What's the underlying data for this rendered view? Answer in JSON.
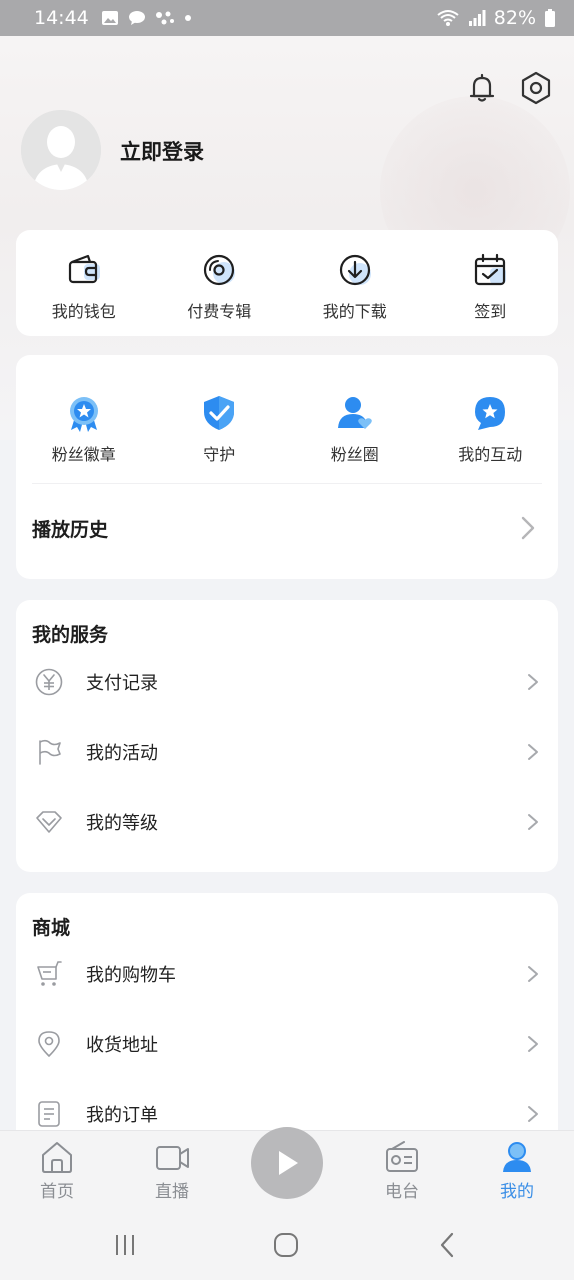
{
  "status_bar": {
    "time": "14:44",
    "battery": "82%"
  },
  "profile": {
    "login_label": "立即登录"
  },
  "quick_actions": [
    {
      "label": "我的钱包",
      "icon": "wallet-icon"
    },
    {
      "label": "付费专辑",
      "icon": "disc-icon"
    },
    {
      "label": "我的下载",
      "icon": "download-icon"
    },
    {
      "label": "签到",
      "icon": "calendar-check-icon"
    }
  ],
  "fan_actions": [
    {
      "label": "粉丝徽章",
      "icon": "badge-icon"
    },
    {
      "label": "守护",
      "icon": "shield-check-icon"
    },
    {
      "label": "粉丝圈",
      "icon": "fan-circle-icon"
    },
    {
      "label": "我的互动",
      "icon": "interaction-star-icon"
    }
  ],
  "history": {
    "label": "播放历史"
  },
  "services": {
    "title": "我的服务",
    "items": [
      {
        "label": "支付记录",
        "icon": "yen-icon"
      },
      {
        "label": "我的活动",
        "icon": "flag-icon"
      },
      {
        "label": "我的等级",
        "icon": "diamond-icon"
      }
    ]
  },
  "mall": {
    "title": "商城",
    "items": [
      {
        "label": "我的购物车",
        "icon": "cart-icon"
      },
      {
        "label": "收货地址",
        "icon": "location-icon"
      },
      {
        "label": "我的订单",
        "icon": "order-icon"
      }
    ]
  },
  "tabs": [
    {
      "label": "首页",
      "icon": "home-icon"
    },
    {
      "label": "直播",
      "icon": "video-icon"
    },
    {
      "label": "电台",
      "icon": "radio-icon"
    },
    {
      "label": "我的",
      "icon": "profile-icon",
      "active": true
    }
  ],
  "colors": {
    "accent": "#3a8ee6",
    "icon_blue": "#2d8cf0"
  }
}
